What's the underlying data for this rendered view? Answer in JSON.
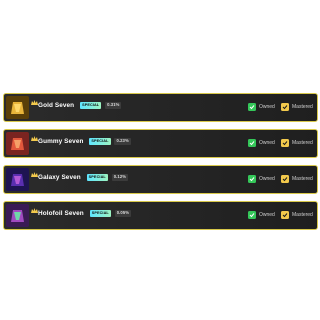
{
  "items": [
    {
      "name": "Gold Seven",
      "badge": "SPECIAL",
      "percent": "0.31%",
      "owned_label": "Owned",
      "mastered_label": "Mastered",
      "colors": [
        "#7a5a10",
        "#f2c14a"
      ]
    },
    {
      "name": "Gummy Seven",
      "badge": "SPECIAL",
      "percent": "0.23%",
      "owned_label": "Owned",
      "mastered_label": "Mastered",
      "colors": [
        "#a3332a",
        "#f28a5a"
      ]
    },
    {
      "name": "Galaxy Seven",
      "badge": "SPECIAL",
      "percent": "0.12%",
      "owned_label": "Owned",
      "mastered_label": "Mastered",
      "colors": [
        "#2b1b6e",
        "#8e4ad8"
      ]
    },
    {
      "name": "Holofoil Seven",
      "badge": "SPECIAL",
      "percent": "0.05%",
      "owned_label": "Owned",
      "mastered_label": "Mastered",
      "colors": [
        "#5a2a80",
        "#60d0a8"
      ]
    }
  ],
  "icons": {
    "crown": "crown-icon",
    "check": "check-icon"
  },
  "accent": {
    "border": "#d8c84a",
    "owned": "#34c759",
    "mastered": "#f2c94c"
  }
}
